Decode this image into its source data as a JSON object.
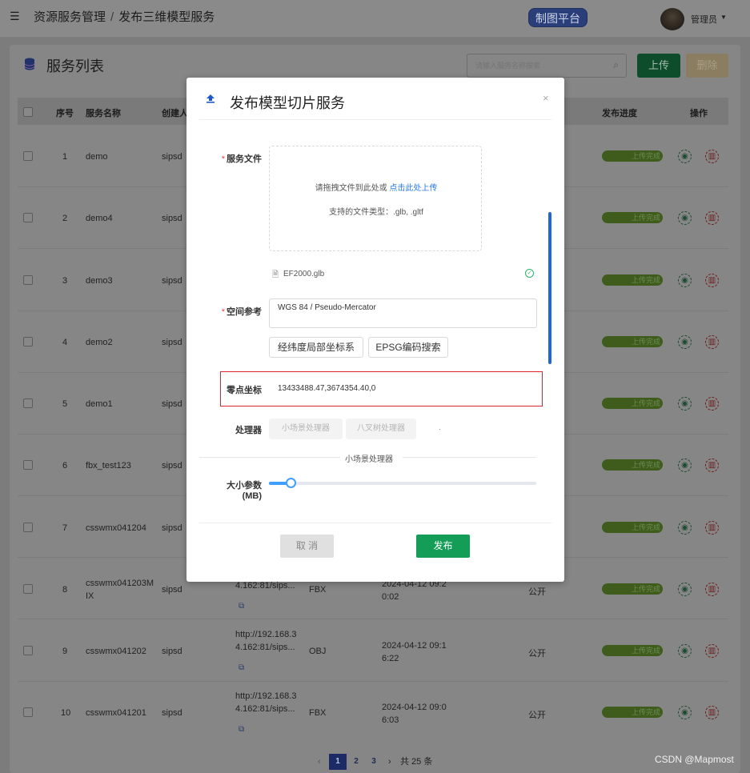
{
  "header": {
    "breadcrumb": [
      "资源服务管理",
      "发布三维模型服务"
    ],
    "breadcrumb_sep": "/",
    "platform_button": "制图平台",
    "user_name": "管理员"
  },
  "list": {
    "title": "服务列表",
    "search_placeholder": "请输入服务名称搜索",
    "upload_label": "上传",
    "delete_label": "删除",
    "columns": {
      "index": "序号",
      "name": "服务名称",
      "creator": "创建人",
      "progress": "发布进度",
      "actions": "操作"
    },
    "rows": [
      {
        "index": "1",
        "name": "demo",
        "creator": "sipsd",
        "status": "上传完成"
      },
      {
        "index": "2",
        "name": "demo4",
        "creator": "sipsd",
        "status": "上传完成"
      },
      {
        "index": "3",
        "name": "demo3",
        "creator": "sipsd",
        "status": "上传完成"
      },
      {
        "index": "4",
        "name": "demo2",
        "creator": "sipsd",
        "status": "上传完成"
      },
      {
        "index": "5",
        "name": "demo1",
        "creator": "sipsd",
        "status": "上传完成"
      },
      {
        "index": "6",
        "name": "fbx_test123",
        "creator": "sipsd",
        "status": "上传完成"
      },
      {
        "index": "7",
        "name": "csswmx041204",
        "creator": "sipsd",
        "status": "上传完成"
      },
      {
        "index": "8",
        "name_line1": "csswmx041203M",
        "name_line2": "IX",
        "creator": "sipsd",
        "url_line2": "4.162:81/sips...",
        "format": "FBX",
        "time_line1": "2024-04-12 09:2",
        "time_line2": "0:02",
        "visibility": "公开",
        "status": "上传完成"
      },
      {
        "index": "9",
        "name": "csswmx041202",
        "creator": "sipsd",
        "url_line1": "http://192.168.3",
        "url_line2": "4.162:81/sips...",
        "format": "OBJ",
        "time_line1": "2024-04-12 09:1",
        "time_line2": "6:22",
        "visibility": "公开",
        "status": "上传完成"
      },
      {
        "index": "10",
        "name": "csswmx041201",
        "creator": "sipsd",
        "url_line1": "http://192.168.3",
        "url_line2": "4.162:81/sips...",
        "format": "FBX",
        "time_line1": "2024-04-12 09:0",
        "time_line2": "6:03",
        "visibility": "公开",
        "status": "上传完成"
      }
    ],
    "pager": {
      "prev": "‹",
      "pages": [
        "1",
        "2",
        "3"
      ],
      "next": "›",
      "total": "共 25 条"
    }
  },
  "modal": {
    "title": "发布模型切片服务",
    "close": "×",
    "file_label": "服务文件",
    "dropzone_text": "请拖拽文件到此处或",
    "dropzone_link": "点击此处上传",
    "dropzone_types": "支持的文件类型：.glb, .gltf",
    "uploaded_file": "EF2000.glb",
    "srs_label": "空间参考",
    "srs_value": "WGS 84 / Pseudo-Mercator",
    "local_crs_button": "经纬度局部坐标系",
    "epsg_button": "EPSG编码搜索",
    "zero_label": "零点坐标",
    "zero_value": "13433488.47,3674354.40,0",
    "processor_label": "处理器",
    "processor_small": "小场景处理器",
    "processor_octree": "八叉树处理器",
    "section_title": "小场景处理器",
    "size_label": "大小参数(MB)",
    "size_slider_fraction": 0.08,
    "cancel_label": "取 消",
    "publish_label": "发布"
  },
  "watermark": "CSDN @Mapmost",
  "colors": {
    "primary_green": "#149d56",
    "link_blue": "#2a7be4",
    "highlight_red": "#e0262b",
    "slider_blue": "#409eff"
  }
}
